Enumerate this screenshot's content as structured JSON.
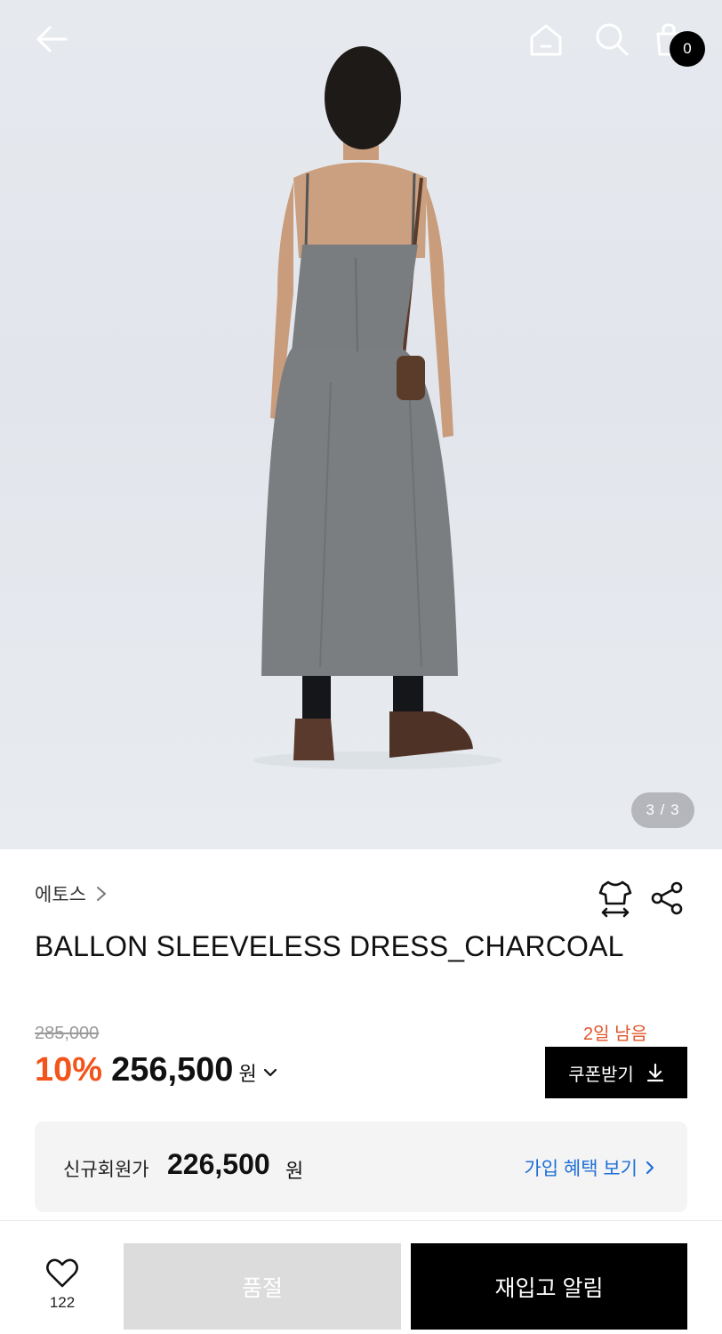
{
  "header": {
    "back_icon": "arrow-left-icon",
    "home_icon": "home-icon",
    "search_icon": "search-icon",
    "cart_icon": "shopping-bag-icon",
    "cart_count": "0"
  },
  "gallery": {
    "indicator": "3 / 3"
  },
  "product": {
    "brand": "에토스",
    "title": "BALLON SLEEVELESS DRESS_CHARCOAL",
    "size_icon": "size-guide-icon",
    "share_icon": "share-icon"
  },
  "pricing": {
    "original_price": "285,000",
    "discount": "10%",
    "sale_price": "256,500",
    "currency": "원",
    "days_left": "2일 남음",
    "coupon_label": "쿠폰받기",
    "accent_color": "#f2541b"
  },
  "member": {
    "label": "신규회원가",
    "price": "226,500",
    "currency": "원",
    "link_label": "가입 혜택 보기"
  },
  "bottom_bar": {
    "like_count": "122",
    "soldout_label": "품절",
    "restock_label": "재입고 알림"
  }
}
